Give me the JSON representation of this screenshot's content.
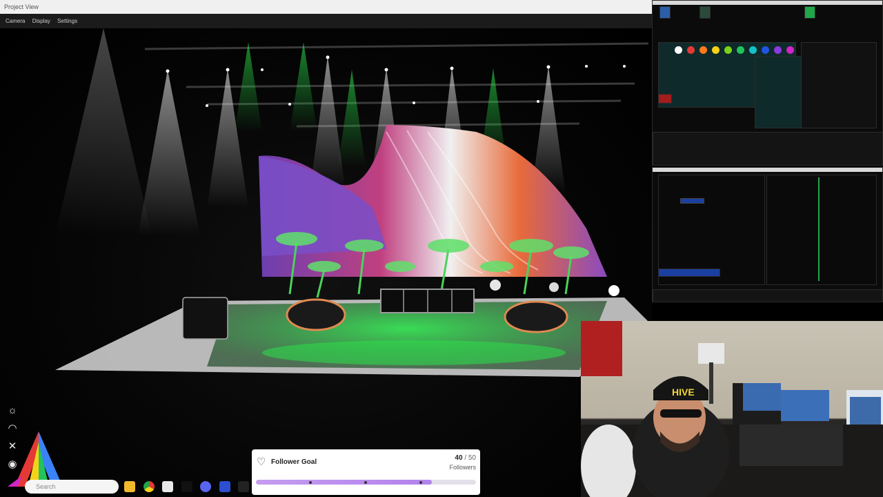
{
  "project_view": {
    "title": "Project View",
    "menu": [
      "Camera",
      "Display",
      "Settings"
    ]
  },
  "viewport_tools": [
    {
      "icon": "sun-icon",
      "glyph": "☼"
    },
    {
      "icon": "gauge-icon",
      "glyph": "◠"
    },
    {
      "icon": "crossed-tools-icon",
      "glyph": "✕"
    },
    {
      "icon": "person-icon",
      "glyph": "◉"
    }
  ],
  "colors": {
    "stage_green": "#2be04a",
    "goal_fill": "#b283ec",
    "console_green": "#1ea84a"
  },
  "taskbar": {
    "search_placeholder": "Search",
    "icons": [
      "folder-icon",
      "chrome-icon",
      "mail-icon",
      "tiktok-icon",
      "discord-icon",
      "app-icon",
      "g-icon"
    ]
  },
  "follower_goal": {
    "title": "Follower Goal",
    "current": "40",
    "separator": "/",
    "target": "50",
    "unit": "Followers",
    "progress": 0.8
  }
}
